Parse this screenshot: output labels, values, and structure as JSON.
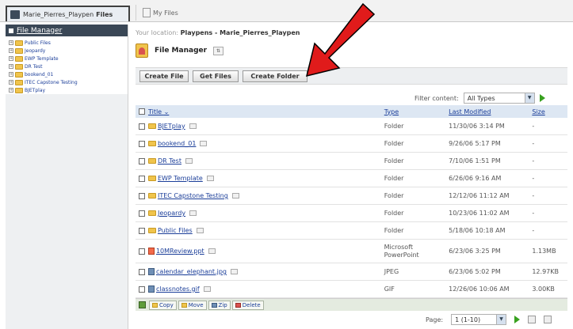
{
  "tabs": [
    {
      "label": "Marie_Pierres_Playpen",
      "bold": "Files"
    },
    {
      "label": "My Files"
    }
  ],
  "sidebar": {
    "header": "File Manager",
    "items": [
      {
        "label": "Public Files"
      },
      {
        "label": "Jeopardy"
      },
      {
        "label": "EWP Template"
      },
      {
        "label": "DR Test"
      },
      {
        "label": "bookend_01"
      },
      {
        "label": "ITEC Capstone Testing"
      },
      {
        "label": "BJETplay"
      }
    ]
  },
  "location": {
    "prefix": "Your location:",
    "path": "Playpens - Marie_Pierres_Playpen"
  },
  "page_title": "File Manager",
  "toolbar": {
    "create_file": "Create File",
    "get_files": "Get Files",
    "create_folder": "Create Folder"
  },
  "filter": {
    "label": "Filter content:",
    "value": "All Types"
  },
  "table": {
    "headers": {
      "title": "Title",
      "type": "Type",
      "modified": "Last Modified",
      "size": "Size"
    },
    "rows": [
      {
        "title": "BJETplay",
        "type": "Folder",
        "modified": "11/30/06 3:14 PM",
        "size": "-",
        "kind": "folder"
      },
      {
        "title": "bookend_01",
        "type": "Folder",
        "modified": "9/26/06 5:17 PM",
        "size": "-",
        "kind": "folder"
      },
      {
        "title": "DR Test",
        "type": "Folder",
        "modified": "7/10/06 1:51 PM",
        "size": "-",
        "kind": "folder"
      },
      {
        "title": "EWP Template",
        "type": "Folder",
        "modified": "6/26/06 9:16 AM",
        "size": "-",
        "kind": "folder"
      },
      {
        "title": "ITEC Capstone Testing",
        "type": "Folder",
        "modified": "12/12/06 11:12 AM",
        "size": "-",
        "kind": "folder"
      },
      {
        "title": "Jeopardy",
        "type": "Folder",
        "modified": "10/23/06 11:02 AM",
        "size": "-",
        "kind": "folder"
      },
      {
        "title": "Public Files",
        "type": "Folder",
        "modified": "5/18/06 10:18 AM",
        "size": "-",
        "kind": "folder"
      },
      {
        "title": "10MReview.ppt",
        "type": "Microsoft PowerPoint",
        "modified": "6/23/06 3:25 PM",
        "size": "1.13MB",
        "kind": "ppt"
      },
      {
        "title": "calendar_elephant.jpg",
        "type": "JPEG",
        "modified": "6/23/06 5:02 PM",
        "size": "12.97KB",
        "kind": "img"
      },
      {
        "title": "classnotes.gif",
        "type": "GIF",
        "modified": "12/26/06 10:06 AM",
        "size": "3.00KB",
        "kind": "img"
      }
    ]
  },
  "actions": {
    "copy": "Copy",
    "move": "Move",
    "zip": "Zip",
    "delete": "Delete"
  },
  "pager": {
    "label": "Page:",
    "value": "1 (1-10)"
  },
  "colors": {
    "header_bg": "#3a4756",
    "table_header_bg": "#dde7f3",
    "link": "#1b3e99",
    "arrow": "#e01b1b"
  }
}
